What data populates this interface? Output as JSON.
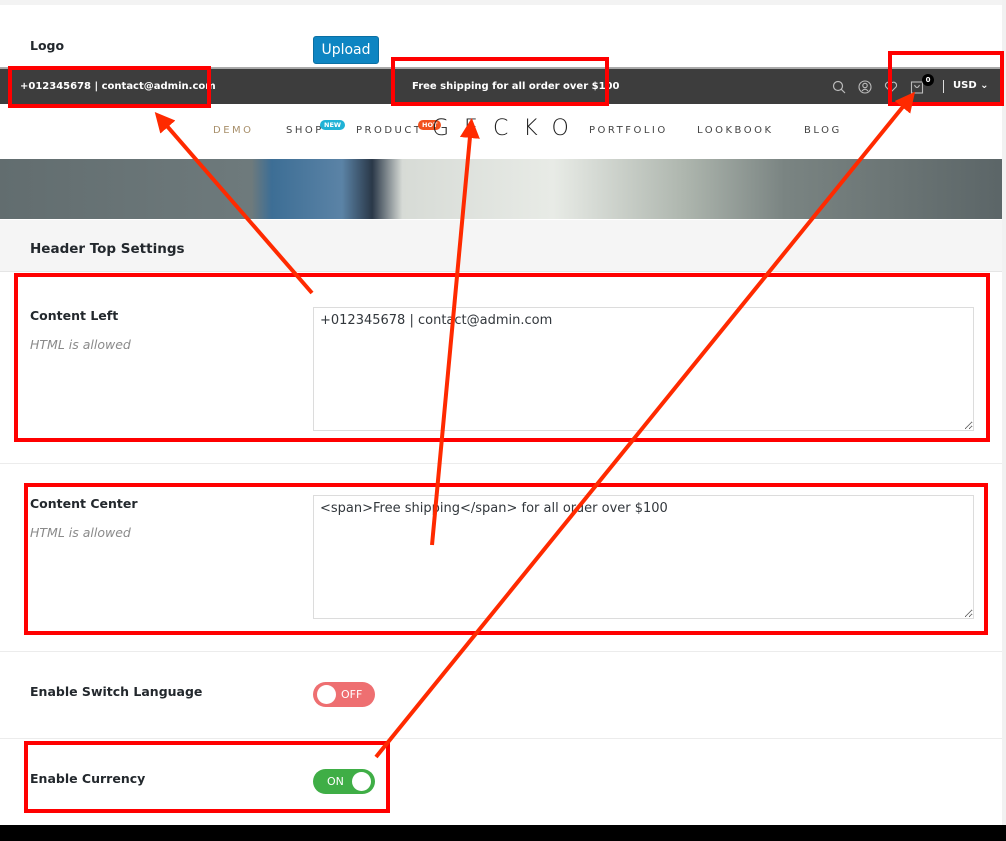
{
  "logo_setting": {
    "label": "Logo",
    "upload_label": "Upload"
  },
  "preview": {
    "top_left": "+012345678 | contact@admin.com",
    "top_center": "Free shipping for all order over $100",
    "icons": [
      "search-icon",
      "user-icon",
      "heart-icon",
      "cart-icon"
    ],
    "cart_count": "0",
    "currency": "USD",
    "currency_caret": "⌄",
    "nav": {
      "items": [
        {
          "label": "DEMO",
          "active": true
        },
        {
          "label": "SHOP",
          "badge": "NEW",
          "badge_color": "#1fb2d6"
        },
        {
          "label": "PRODUCT",
          "badge": "HOT",
          "badge_color": "#f1521f"
        },
        {
          "label": "PORTFOLIO"
        },
        {
          "label": "LOOKBOOK"
        },
        {
          "label": "BLOG"
        }
      ],
      "logo": "GECKO"
    }
  },
  "section": {
    "title": "Header Top Settings"
  },
  "fields": {
    "content_left": {
      "label": "Content Left",
      "hint": "HTML is allowed",
      "value": "+012345678 | contact@admin.com"
    },
    "content_center": {
      "label": "Content Center",
      "hint": "HTML is allowed",
      "value": "<span>Free shipping</span> for all order over $100"
    },
    "switch_language": {
      "label": "Enable Switch Language",
      "state": "OFF",
      "color": "#ee6f71"
    },
    "currency": {
      "label": "Enable Currency",
      "state": "ON",
      "color": "#3fae46"
    }
  },
  "annotation_color": "#ff0000"
}
